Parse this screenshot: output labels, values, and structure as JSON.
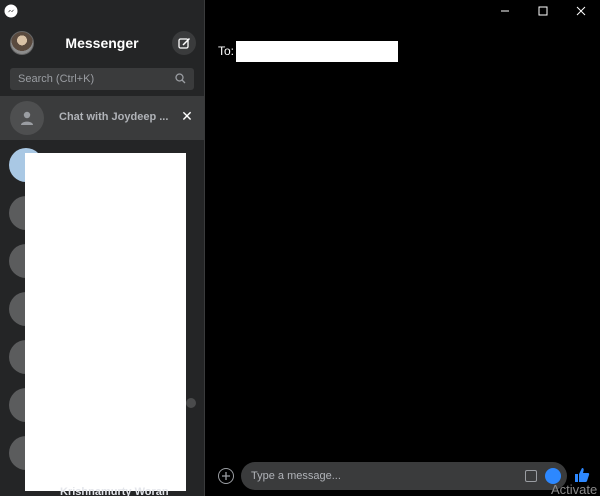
{
  "sidebar": {
    "title": "Messenger",
    "search_placeholder": "Search (Ctrl+K)",
    "active_chat": "Chat with Joydeep ...",
    "close_symbol": "✕",
    "bottom_contact": "Krishnamurty Woran"
  },
  "conversation": {
    "to_label": "To:",
    "composer_placeholder": "Type a message..."
  },
  "window": {
    "minimize": "—",
    "maximize": "☐",
    "close": "✕"
  },
  "watermark": "Activate",
  "colors": {
    "sidebar_bg": "#242526",
    "accent": "#0084ff",
    "main_bg": "#000000"
  },
  "icons": [
    "messenger-logo-icon",
    "compose-icon",
    "search-icon",
    "person-icon",
    "close-icon",
    "plus-icon",
    "sticker-icon",
    "emoji-icon",
    "like-icon"
  ]
}
